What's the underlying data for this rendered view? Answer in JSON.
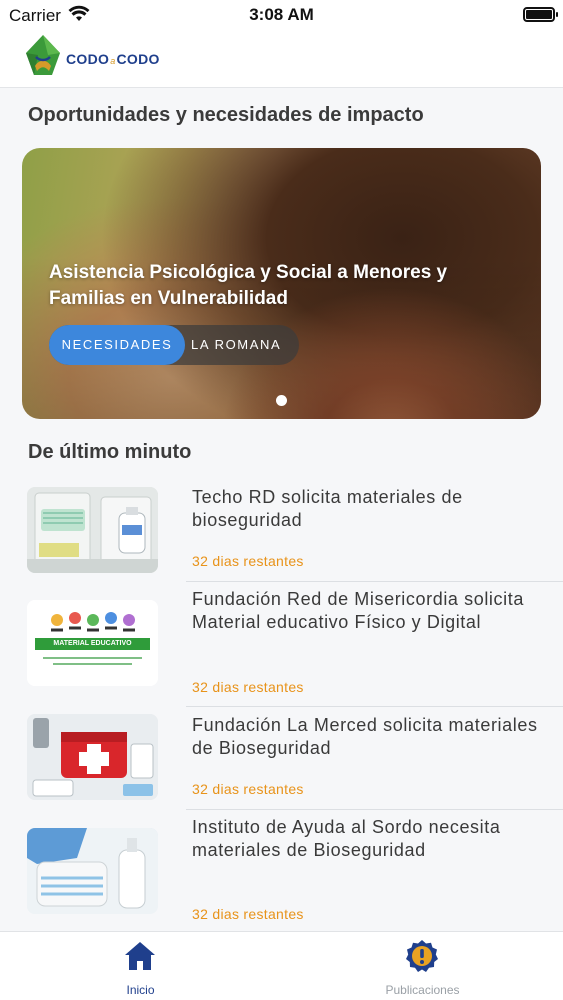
{
  "status_bar": {
    "carrier": "Carrier",
    "time": "3:08 AM"
  },
  "header": {
    "logo_text_left": "CODO",
    "logo_text_mid": "a",
    "logo_text_right": "CODO",
    "logo_colors": [
      "#3b9a3a",
      "#1f3f8c",
      "#d59a2a"
    ]
  },
  "sections": {
    "opportunities_title": "Oportunidades y necesidades de impacto",
    "latest_title": "De último minuto"
  },
  "carousel": {
    "card_title": "Asistencia Psicológica y Social a Menores y Familias en Vulnerabilidad",
    "chip_type": "NECESIDADES",
    "chip_location": "LA ROMANA",
    "page_count": 1,
    "active_page": 1
  },
  "news": [
    {
      "title": "Techo RD solicita materiales de bioseguridad",
      "meta": "32 dias restantes",
      "thumb": "bioseguridad-kit"
    },
    {
      "title": "Fundación Red de Misericordia solicita Material educativo Físico y Digital",
      "meta": "32 dias restantes",
      "thumb": "material-educativo",
      "thumb_banner": "MATERIAL EDUCATIVO"
    },
    {
      "title": "Fundación La Merced solicita materiales de Bioseguridad",
      "meta": "32 dias restantes",
      "thumb": "first-aid-kit"
    },
    {
      "title": "Instituto de Ayuda al Sordo necesita materiales de Bioseguridad",
      "meta": "32 dias restantes",
      "thumb": "masks-gloves"
    }
  ],
  "tab_bar": {
    "tabs": [
      {
        "label": "Inicio",
        "icon": "home-icon",
        "active": true
      },
      {
        "label": "Publicaciones",
        "icon": "alert-badge-icon",
        "active": false
      }
    ],
    "active_color": "#1f3f8c",
    "inactive_color": "#9aa0a6"
  },
  "accent": {
    "chip_blue": "#3d87dc",
    "deadline_orange": "#e8931a"
  }
}
